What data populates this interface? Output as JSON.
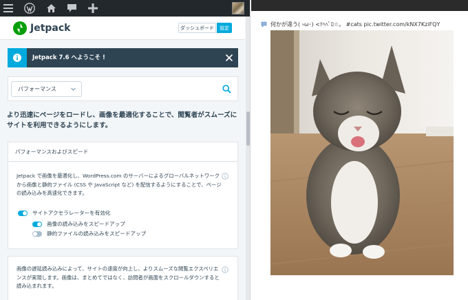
{
  "admin_bar": {
    "icons": [
      "menu-icon",
      "wordpress-logo-icon",
      "home-icon",
      "comment-icon",
      "plus-icon",
      "avatar"
    ]
  },
  "header": {
    "title": "Jetpack",
    "dashboard_button": "ダッシュボード",
    "settings_button": "設定"
  },
  "notice": {
    "text": "Jetpack 7.6 へようこそ !"
  },
  "filter": {
    "selected": "パフォーマンス"
  },
  "intro": "より迅速にページをロードし、画像を最適化することで、閲覧者がスムーズにサイトを利用できるようにします。",
  "section": {
    "title": "パフォーマンスおよびスピード"
  },
  "accelerator": {
    "description": "Jetpack で画像を最適化し、WordPress.com のサーバーによるグローバルネットワークから画像と静的ファイル (CSS や JavaScript など) を配信するようにすることで、ページの読み込みを高速化できます。",
    "toggles": [
      {
        "label": "サイトアクセラレーターを有効化",
        "on": true
      },
      {
        "label": "画像の読み込みをスピードアップ",
        "on": true
      },
      {
        "label": "静的ファイルの読み込みをスピードアップ",
        "on": false
      }
    ]
  },
  "lazy": {
    "description": "画像の遅延読み込みによって、サイトの速度が向上し、よりスムーズな閲覧エクスペリエンスが実現します。画像は、まとめてではなく、訪問者が画面をスクロールダウンすると読み込まれます。"
  },
  "tweet": {
    "text": "何かが違う( ›ω･) <ﾃﾍﾍﾟﾛ☆。 #cats pic.twitter.com/kNX7KziFQY"
  },
  "colors": {
    "admin_bar": "#23282d",
    "accent": "#00aadc",
    "jetpack_green": "#069e08",
    "notice_bg": "#2e4453",
    "text": "#2e4453"
  }
}
